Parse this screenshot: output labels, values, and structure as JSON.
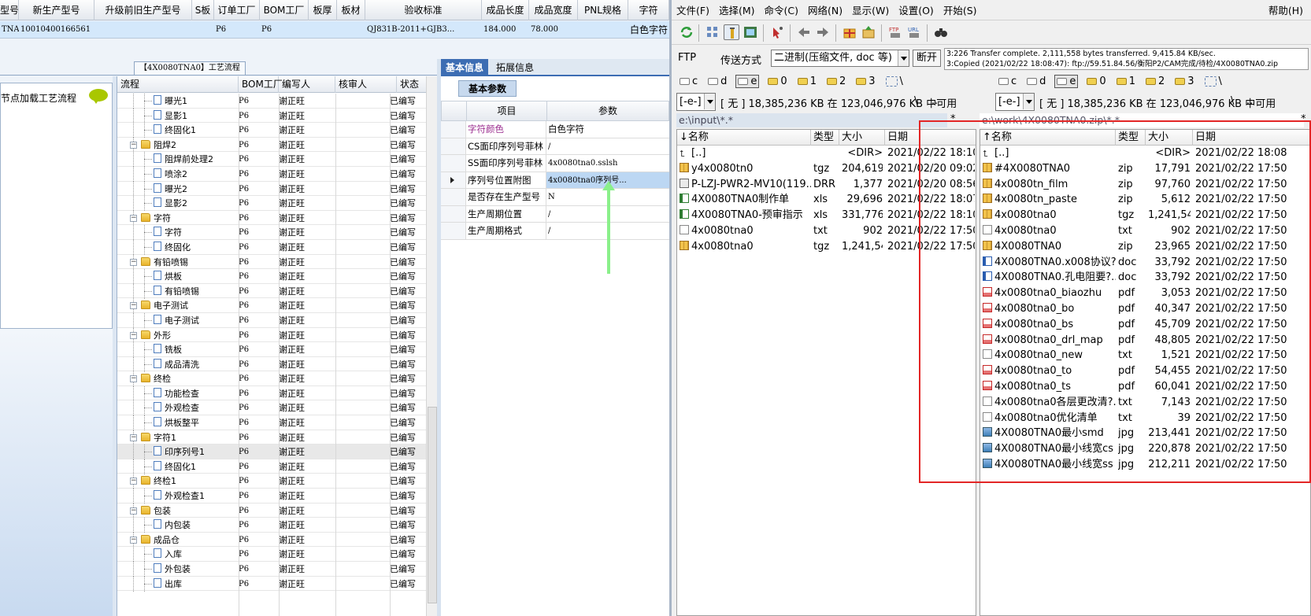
{
  "order_table": {
    "headers": [
      "型号",
      "新生产型号",
      "升级前旧生产型号",
      "S板",
      "订单工厂",
      "BOM工厂",
      "板厚",
      "板材",
      "验收标准",
      "成品长度",
      "成品宽度",
      "PNL规格",
      "字符"
    ],
    "row": [
      "TNA0",
      "10010400166561",
      "",
      "",
      "P6",
      "P6",
      "",
      "",
      "QJ831B-2011+GJB3...",
      "184.000",
      "78.000",
      "",
      "白色字符"
    ]
  },
  "process": {
    "title": "【4X0080TNA0】工艺流程",
    "node_text": "节点加载工艺流程",
    "headers": [
      "流程",
      "BOM工厂",
      "编写人",
      "核审人",
      "状态"
    ],
    "rows": [
      {
        "name": "曝光1",
        "level": 2,
        "type": "doc",
        "bom": "P6",
        "writer": "谢正旺",
        "status": "已编写"
      },
      {
        "name": "显影1",
        "level": 2,
        "type": "doc",
        "bom": "P6",
        "writer": "谢正旺",
        "status": "已编写"
      },
      {
        "name": "终固化1",
        "level": 2,
        "type": "doc",
        "bom": "P6",
        "writer": "谢正旺",
        "status": "已编写"
      },
      {
        "name": "阻焊2",
        "level": 1,
        "type": "folder",
        "bom": "P6",
        "writer": "谢正旺",
        "status": "已编写"
      },
      {
        "name": "阻焊前处理2",
        "level": 2,
        "type": "doc",
        "bom": "P6",
        "writer": "谢正旺",
        "status": "已编写"
      },
      {
        "name": "喷涂2",
        "level": 2,
        "type": "doc",
        "bom": "P6",
        "writer": "谢正旺",
        "status": "已编写"
      },
      {
        "name": "曝光2",
        "level": 2,
        "type": "doc",
        "bom": "P6",
        "writer": "谢正旺",
        "status": "已编写"
      },
      {
        "name": "显影2",
        "level": 2,
        "type": "doc",
        "bom": "P6",
        "writer": "谢正旺",
        "status": "已编写"
      },
      {
        "name": "字符",
        "level": 1,
        "type": "folder",
        "bom": "P6",
        "writer": "谢正旺",
        "status": "已编写"
      },
      {
        "name": "字符",
        "level": 2,
        "type": "doc",
        "bom": "P6",
        "writer": "谢正旺",
        "status": "已编写"
      },
      {
        "name": "终固化",
        "level": 2,
        "type": "doc",
        "bom": "P6",
        "writer": "谢正旺",
        "status": "已编写"
      },
      {
        "name": "有铅喷锡",
        "level": 1,
        "type": "folder",
        "bom": "P6",
        "writer": "谢正旺",
        "status": "已编写"
      },
      {
        "name": "烘板",
        "level": 2,
        "type": "doc",
        "bom": "P6",
        "writer": "谢正旺",
        "status": "已编写"
      },
      {
        "name": "有铅喷锡",
        "level": 2,
        "type": "doc",
        "bom": "P6",
        "writer": "谢正旺",
        "status": "已编写"
      },
      {
        "name": "电子测试",
        "level": 1,
        "type": "folder",
        "bom": "P6",
        "writer": "谢正旺",
        "status": "已编写"
      },
      {
        "name": "电子测试",
        "level": 2,
        "type": "doc",
        "bom": "P6",
        "writer": "谢正旺",
        "status": "已编写"
      },
      {
        "name": "外形",
        "level": 1,
        "type": "folder",
        "bom": "P6",
        "writer": "谢正旺",
        "status": "已编写"
      },
      {
        "name": "铣板",
        "level": 2,
        "type": "doc",
        "bom": "P6",
        "writer": "谢正旺",
        "status": "已编写"
      },
      {
        "name": "成品清洗",
        "level": 2,
        "type": "doc",
        "bom": "P6",
        "writer": "谢正旺",
        "status": "已编写"
      },
      {
        "name": "终检",
        "level": 1,
        "type": "folder",
        "bom": "P6",
        "writer": "谢正旺",
        "status": "已编写"
      },
      {
        "name": "功能检查",
        "level": 2,
        "type": "doc",
        "bom": "P6",
        "writer": "谢正旺",
        "status": "已编写"
      },
      {
        "name": "外观检查",
        "level": 2,
        "type": "doc",
        "bom": "P6",
        "writer": "谢正旺",
        "status": "已编写"
      },
      {
        "name": "烘板整平",
        "level": 2,
        "type": "doc",
        "bom": "P6",
        "writer": "谢正旺",
        "status": "已编写"
      },
      {
        "name": "字符1",
        "level": 1,
        "type": "folder",
        "bom": "P6",
        "writer": "谢正旺",
        "status": "已编写"
      },
      {
        "name": "印序列号1",
        "level": 2,
        "type": "doc",
        "bom": "P6",
        "writer": "谢正旺",
        "status": "已编写",
        "selected": true
      },
      {
        "name": "终固化1",
        "level": 2,
        "type": "doc",
        "bom": "P6",
        "writer": "谢正旺",
        "status": "已编写"
      },
      {
        "name": "终检1",
        "level": 1,
        "type": "folder",
        "bom": "P6",
        "writer": "谢正旺",
        "status": "已编写"
      },
      {
        "name": "外观检查1",
        "level": 2,
        "type": "doc",
        "bom": "P6",
        "writer": "谢正旺",
        "status": "已编写"
      },
      {
        "name": "包装",
        "level": 1,
        "type": "folder",
        "bom": "P6",
        "writer": "谢正旺",
        "status": "已编写"
      },
      {
        "name": "内包装",
        "level": 2,
        "type": "doc",
        "bom": "P6",
        "writer": "谢正旺",
        "status": "已编写"
      },
      {
        "name": "成品仓",
        "level": 1,
        "type": "folder",
        "bom": "P6",
        "writer": "谢正旺",
        "status": "已编写"
      },
      {
        "name": "入库",
        "level": 2,
        "type": "doc",
        "bom": "P6",
        "writer": "谢正旺",
        "status": "已编写"
      },
      {
        "name": "外包装",
        "level": 2,
        "type": "doc",
        "bom": "P6",
        "writer": "谢正旺",
        "status": "已编写"
      },
      {
        "name": "出库",
        "level": 2,
        "type": "doc",
        "bom": "P6",
        "writer": "谢正旺",
        "status": "已编写"
      }
    ]
  },
  "properties": {
    "tabs": [
      "基本信息",
      "拓展信息"
    ],
    "subtab": "基本参数",
    "headers": [
      "项目",
      "参数"
    ],
    "rows": [
      {
        "key": "字符颜色",
        "value": "白色字符",
        "key_color": "#9b2d8f"
      },
      {
        "key": "CS面印序列号菲林",
        "value": "/"
      },
      {
        "key": "SS面印序列号菲林",
        "value": "4x0080tna0.sslsh"
      },
      {
        "key": "序列号位置附图",
        "value": "4x0080tna0序列号...",
        "selected": true
      },
      {
        "key": "是否存在生产型号",
        "value": "N"
      },
      {
        "key": "生产周期位置",
        "value": "/"
      },
      {
        "key": "生产周期格式",
        "value": "/"
      }
    ]
  },
  "ftp_client": {
    "menu": [
      "文件(F)",
      "选择(M)",
      "命令(C)",
      "网络(N)",
      "显示(W)",
      "设置(O)",
      "开始(S)"
    ],
    "help": "帮助(H)",
    "ftp_label": "FTP",
    "mode_label": "传送方式",
    "mode_value": "二进制(压缩文件, doc 等)",
    "disconnect": "断开",
    "log_lines": [
      "3:226 Transfer complete. 2,111,558 bytes transferred. 9,415.84 KB/sec.",
      "3:Copied (2021/02/22 18:08:47): ftp://59.51.84.56/衡阳P2/CAM完成/待检/4X0080TNA0.zip"
    ],
    "drives": [
      "c",
      "d",
      "e",
      "0",
      "1",
      "2",
      "3",
      "\\"
    ],
    "left": {
      "drive": "[-e-]",
      "free": "[ 无 ]  18,385,236 KB 在 123,046,976 KB 中可用",
      "path": "e:\\input\\*.*",
      "columns": [
        "↓名称",
        "类型",
        "大小",
        "日期"
      ],
      "files": [
        {
          "icon": "up",
          "name": "[..]",
          "type": "",
          "size": "<DIR>",
          "date": "2021/02/22 18:10"
        },
        {
          "icon": "zip",
          "name": "y4x0080tn0",
          "type": "tgz",
          "size": "204,619",
          "date": "2021/02/20 09:02"
        },
        {
          "icon": "drr",
          "name": "P-LZJ-PWR2-MV10(119...",
          "type": "DRR",
          "size": "1,377",
          "date": "2021/02/20 08:56"
        },
        {
          "icon": "xls",
          "name": "4X0080TNA0制作单",
          "type": "xls",
          "size": "29,696",
          "date": "2021/02/22 18:07"
        },
        {
          "icon": "xls",
          "name": "4X0080TNA0-预审指示",
          "type": "xls",
          "size": "331,776",
          "date": "2021/02/22 18:10"
        },
        {
          "icon": "txt",
          "name": "4x0080tna0",
          "type": "txt",
          "size": "902",
          "date": "2021/02/22 17:50"
        },
        {
          "icon": "zip",
          "name": "4x0080tna0",
          "type": "tgz",
          "size": "1,241,541",
          "date": "2021/02/22 17:50"
        }
      ]
    },
    "right": {
      "drive": "[-e-]",
      "free": "[ 无 ]  18,385,236 KB 在 123,046,976 KB 中可用",
      "path": "e:\\work\\4X0080TNA0.zip\\*.*",
      "columns": [
        "↑名称",
        "类型",
        "大小",
        "日期"
      ],
      "files": [
        {
          "icon": "up",
          "name": "[..]",
          "type": "",
          "size": "<DIR>",
          "date": "2021/02/22 18:08"
        },
        {
          "icon": "zip",
          "name": "#4X0080TNA0",
          "type": "zip",
          "size": "17,791",
          "date": "2021/02/22 17:50"
        },
        {
          "icon": "zip",
          "name": "4x0080tn_film",
          "type": "zip",
          "size": "97,760",
          "date": "2021/02/22 17:50"
        },
        {
          "icon": "zip",
          "name": "4x0080tn_paste",
          "type": "zip",
          "size": "5,612",
          "date": "2021/02/22 17:50"
        },
        {
          "icon": "zip",
          "name": "4x0080tna0",
          "type": "tgz",
          "size": "1,241,541",
          "date": "2021/02/22 17:50"
        },
        {
          "icon": "txt",
          "name": "4x0080tna0",
          "type": "txt",
          "size": "902",
          "date": "2021/02/22 17:50"
        },
        {
          "icon": "zip",
          "name": "4X0080TNA0",
          "type": "zip",
          "size": "23,965",
          "date": "2021/02/22 17:50"
        },
        {
          "icon": "doc",
          "name": "4X0080TNA0.x008协议?...",
          "type": "doc",
          "size": "33,792",
          "date": "2021/02/22 17:50"
        },
        {
          "icon": "doc",
          "name": "4X0080TNA0.孔电阻要?...",
          "type": "doc",
          "size": "33,792",
          "date": "2021/02/22 17:50"
        },
        {
          "icon": "pdf",
          "name": "4x0080tna0_biaozhu",
          "type": "pdf",
          "size": "3,053",
          "date": "2021/02/22 17:50"
        },
        {
          "icon": "pdf",
          "name": "4x0080tna0_bo",
          "type": "pdf",
          "size": "40,347",
          "date": "2021/02/22 17:50"
        },
        {
          "icon": "pdf",
          "name": "4x0080tna0_bs",
          "type": "pdf",
          "size": "45,709",
          "date": "2021/02/22 17:50"
        },
        {
          "icon": "pdf",
          "name": "4x0080tna0_drl_map",
          "type": "pdf",
          "size": "48,805",
          "date": "2021/02/22 17:50"
        },
        {
          "icon": "txt",
          "name": "4x0080tna0_new",
          "type": "txt",
          "size": "1,521",
          "date": "2021/02/22 17:50"
        },
        {
          "icon": "pdf",
          "name": "4x0080tna0_to",
          "type": "pdf",
          "size": "54,455",
          "date": "2021/02/22 17:50"
        },
        {
          "icon": "pdf",
          "name": "4x0080tna0_ts",
          "type": "pdf",
          "size": "60,041",
          "date": "2021/02/22 17:50"
        },
        {
          "icon": "txt",
          "name": "4x0080tna0各层更改清?...",
          "type": "txt",
          "size": "7,143",
          "date": "2021/02/22 17:50"
        },
        {
          "icon": "txt",
          "name": "4x0080tna0优化清单",
          "type": "txt",
          "size": "39",
          "date": "2021/02/22 17:50"
        },
        {
          "icon": "jpg",
          "name": "4X0080TNA0最小smd",
          "type": "jpg",
          "size": "213,441",
          "date": "2021/02/22 17:50"
        },
        {
          "icon": "jpg",
          "name": "4X0080TNA0最小线宽cs",
          "type": "jpg",
          "size": "220,878",
          "date": "2021/02/22 17:50"
        },
        {
          "icon": "jpg",
          "name": "4X0080TNA0最小线宽ss",
          "type": "jpg",
          "size": "212,211",
          "date": "2021/02/22 17:50"
        }
      ]
    }
  },
  "colors": {
    "highlight": "#e32626",
    "arrow": "#8af08a",
    "accent": "#3c6db3"
  }
}
